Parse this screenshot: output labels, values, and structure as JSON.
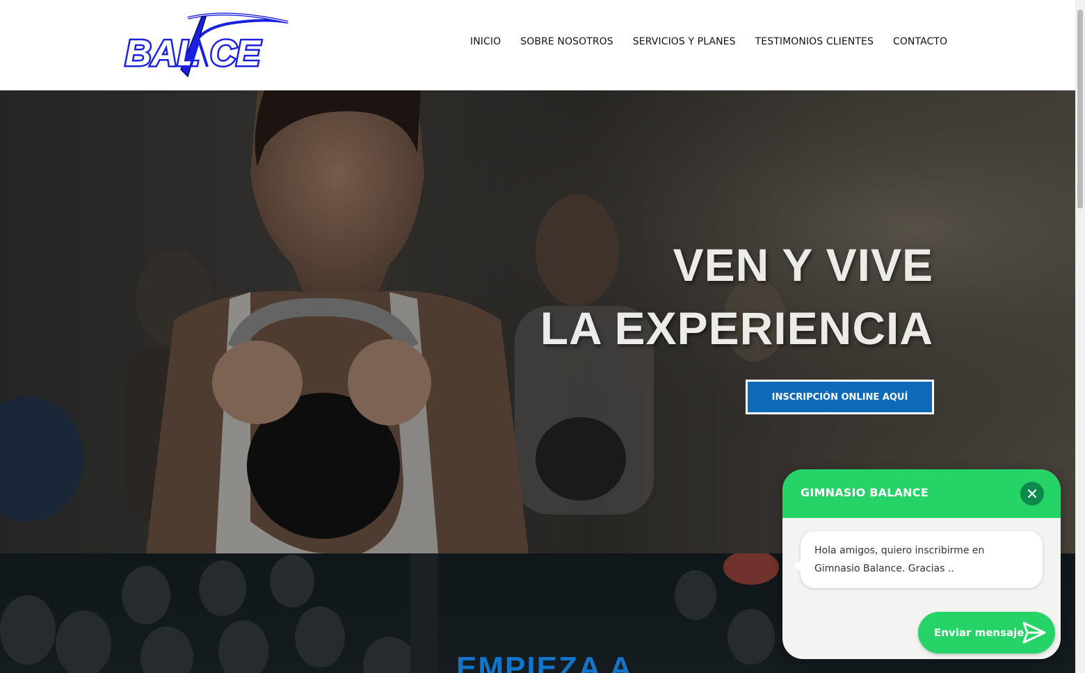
{
  "brand": {
    "logo_text": "BALANCE",
    "logo_alt": "Balance"
  },
  "nav": {
    "items": [
      {
        "label": "INICIO"
      },
      {
        "label": "SOBRE NOSOTROS"
      },
      {
        "label": "SERVICIOS Y PLANES"
      },
      {
        "label": "TESTIMONIOS CLIENTES"
      },
      {
        "label": "CONTACTO"
      }
    ]
  },
  "hero": {
    "title_line1": "VEN Y VIVE",
    "title_line2": "LA EXPERIENCIA",
    "cta_label": "INSCRIPCIÓN ONLINE AQUÍ"
  },
  "section2": {
    "title": "EMPIEZA A"
  },
  "chat": {
    "title": "GIMNASIO BALANCE",
    "message": "Hola amigos, quiero inscribirme en Gimnasio Balance. Gracias ..",
    "send_label": "Enviar mensaje"
  },
  "colors": {
    "brand_blue": "#1a20e0",
    "cta_blue": "#0d6ab8",
    "section_title_blue": "#1474c9",
    "whatsapp_green": "#25d366",
    "chat_close_green": "#0c8a4c"
  },
  "icons": {
    "close": "close-icon",
    "send": "send-icon"
  }
}
